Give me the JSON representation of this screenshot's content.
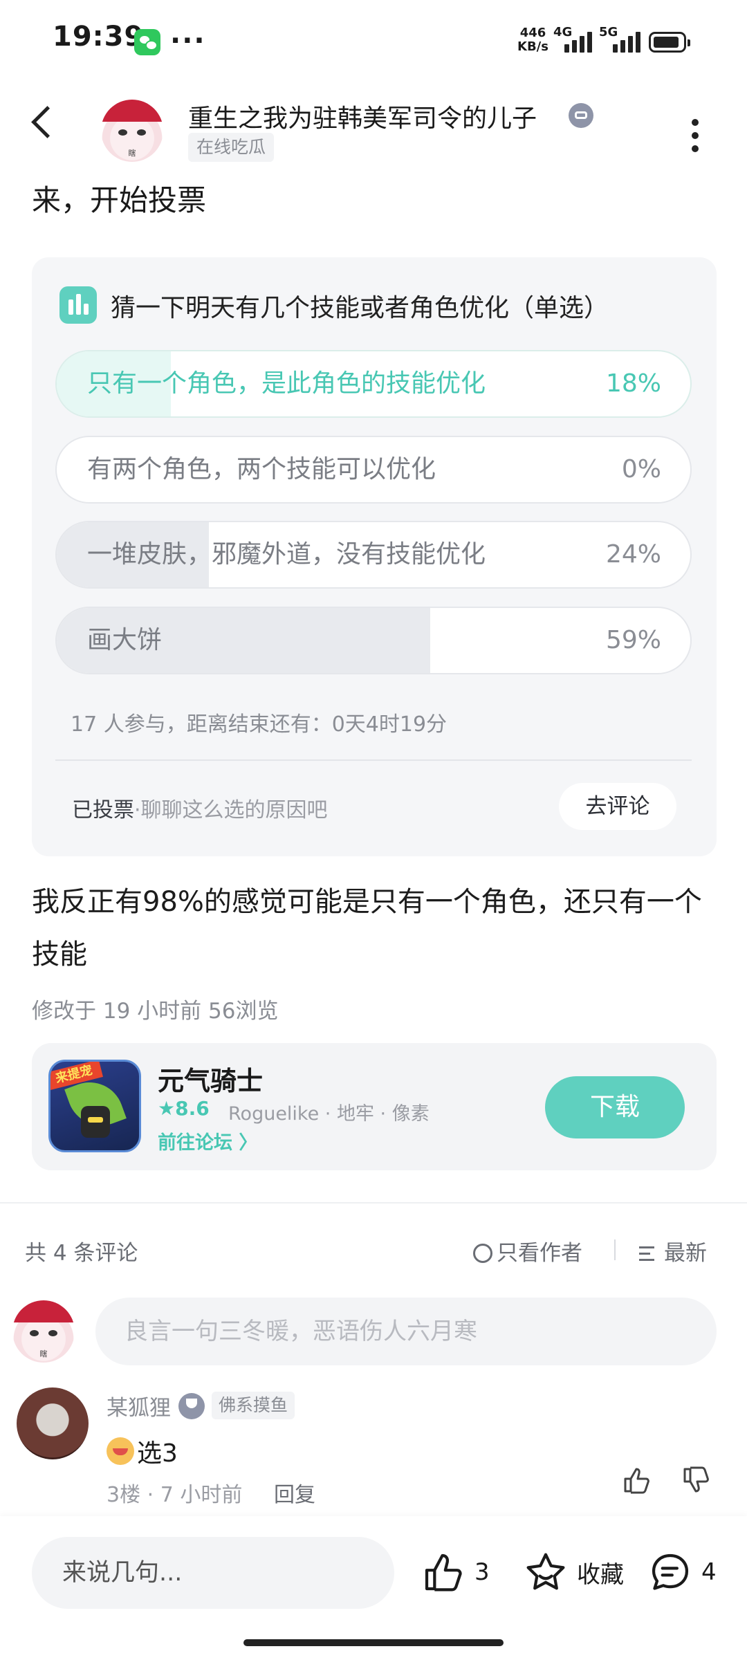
{
  "status_bar": {
    "time": "19:39",
    "more": "···",
    "net_speed_value": "446",
    "net_speed_unit": "KB/s",
    "signal_1_label": "4G",
    "signal_2_label": "5G"
  },
  "header": {
    "username": "重生之我为驻韩美军司令的儿子",
    "status": "在线吃瓜",
    "avatar_tag": "瞎"
  },
  "post": {
    "title": "来，开始投票",
    "body": "我反正有98%的感觉可能是只有一个角色，还只有一个技能",
    "edit_meta": "修改于 19 小时前   56浏览"
  },
  "poll": {
    "question": "猜一下明天有几个技能或者角色优化（单选）",
    "options": [
      {
        "label": "只有一个角色，是此角色的技能优化",
        "percent_text": "18%",
        "percent": 18,
        "selected": true
      },
      {
        "label": "有两个角色，两个技能可以优化",
        "percent_text": "0%",
        "percent": 0,
        "selected": false
      },
      {
        "label": "一堆皮肤，邪魔外道，没有技能优化",
        "percent_text": "24%",
        "percent": 24,
        "selected": false
      },
      {
        "label": "画大饼",
        "percent_text": "59%",
        "percent": 59,
        "selected": false
      }
    ],
    "meta": "17 人参与，距离结束还有：0天4时19分",
    "voted": "已投票",
    "voted_hint": "·聊聊这么选的原因吧",
    "comment_button": "去评论"
  },
  "game": {
    "name": "元气骑士",
    "rating": "★8.6",
    "tags": "Roguelike · 地牢 · 像素",
    "forum_link": "前往论坛 〉",
    "download": "下载",
    "icon_ribbon": "来提宠"
  },
  "comments": {
    "count": "共 4 条评论",
    "only_author": "只看作者",
    "sort": "最新",
    "input_placeholder": "良言一句三冬暖，恶语伤人六月寒",
    "items": [
      {
        "name": "某狐狸",
        "tag": "佛系摸鱼",
        "text": "选3",
        "meta": "3楼 · 7 小时前",
        "reply": "回复"
      }
    ]
  },
  "bottom_bar": {
    "say": "来说几句...",
    "like_count": "3",
    "favorite": "收藏",
    "comment_count": "4"
  }
}
